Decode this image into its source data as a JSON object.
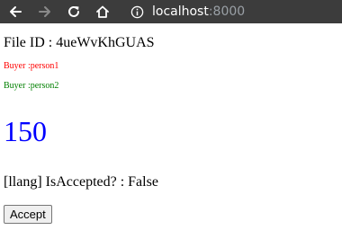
{
  "browser": {
    "url_host": "localhost",
    "url_port": ":8000",
    "icons": {
      "back": "arrow-left-icon",
      "forward": "arrow-right-icon",
      "reload": "reload-icon",
      "home": "home-icon",
      "info": "info-icon"
    }
  },
  "page": {
    "file_id": "File ID : 4ueWvKhGUAS",
    "buyer1": "Buyer :person1",
    "buyer2": "Buyer :person2",
    "price": "150",
    "accepted": "[llang] IsAccepted? : False",
    "accept_button": "Accept"
  },
  "colors": {
    "toolbar_bg": "#3c3c3c",
    "buyer1": "#ff0000",
    "buyer2": "#008000",
    "price": "#0000ff"
  }
}
